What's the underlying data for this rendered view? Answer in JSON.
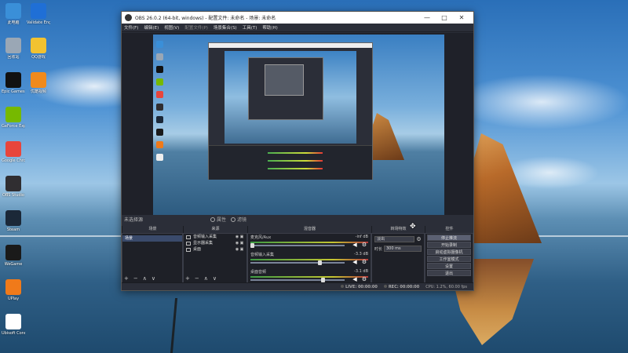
{
  "desktop": {
    "icons_left": [
      {
        "label": "此电脑",
        "icon": "computer-icon",
        "color": "#3a8fd8"
      },
      {
        "label": "回收站",
        "icon": "recycle-bin-icon",
        "color": "#9aa7b5"
      },
      {
        "label": "Epic Games Launcher",
        "icon": "epic-games-icon",
        "color": "#111111"
      },
      {
        "label": "GeForce Experience",
        "icon": "geforce-icon",
        "color": "#76b900"
      },
      {
        "label": "Google Chrome",
        "icon": "chrome-icon",
        "color": "#e8453c"
      },
      {
        "label": "OBS Studio",
        "icon": "obs-icon",
        "color": "#302e31"
      },
      {
        "label": "Steam",
        "icon": "steam-icon",
        "color": "#1b2838"
      },
      {
        "label": "WeGame",
        "icon": "wegame-icon",
        "color": "#1a1a1a"
      },
      {
        "label": "UPlay",
        "icon": "uplay-icon",
        "color": "#f07a1a"
      },
      {
        "label": "Ubisoft Connect",
        "icon": "ubisoft-icon",
        "color": "#ffffff"
      }
    ],
    "icons_right": [
      {
        "label": "Validate Engine",
        "icon": "validate-icon",
        "color": "#1f6fd6"
      },
      {
        "label": "QQ游戏",
        "icon": "qq-game-icon",
        "color": "#f2c230"
      },
      {
        "label": "优酷视频",
        "icon": "youku-icon",
        "color": "#f08a1c"
      }
    ]
  },
  "obs": {
    "title": "OBS 26.0.2 (64-bit, windows) - 配置文件: 未命名 - 场景: 未命名",
    "menu": [
      "文件(F)",
      "编辑(E)",
      "视图(V)",
      "配置文件(P)",
      "场景集合(S)",
      "工具(T)",
      "帮助(H)"
    ],
    "menu_dim_index": 3,
    "no_source_label": "未选择源",
    "props_label": "属性",
    "filters_label": "滤镜",
    "docks": {
      "scenes_title": "场景",
      "sources_title": "来源",
      "mixer_title": "混音器",
      "transitions_title": "转场特效",
      "controls_title": "控件"
    },
    "scenes": [
      "场景"
    ],
    "sources": [
      {
        "name": "音频输入采集"
      },
      {
        "name": "显示器采集"
      },
      {
        "name": "桌面"
      }
    ],
    "mixer": [
      {
        "name": "麦克风/Aux",
        "db": "-inf dB",
        "level": 0.0
      },
      {
        "name": "音频输入采集",
        "db": "-3.3 dB",
        "level": 0.75
      },
      {
        "name": "桌面音频",
        "db": "-3.1 dB",
        "level": 0.78
      }
    ],
    "transition": {
      "type": "淡出",
      "duration_label": "时长",
      "duration": "300 ms"
    },
    "controls": [
      "停止推流",
      "开始录制",
      "启动虚拟摄像机",
      "工作室模式",
      "设置",
      "退出"
    ],
    "controls_active_index": 0,
    "status": {
      "live_label": "LIVE:",
      "live_time": "00:00:00",
      "rec_label": "REC:",
      "rec_time": "00:00:00",
      "cpu": "CPU: 1.2%, 60.00 fps"
    },
    "foot_icons": [
      "+",
      "−",
      "∧",
      "∨"
    ]
  },
  "colors": {
    "obs_bg": "#2b2e38",
    "dock_bg": "#1e2027",
    "accent": "#3a4a6b"
  }
}
